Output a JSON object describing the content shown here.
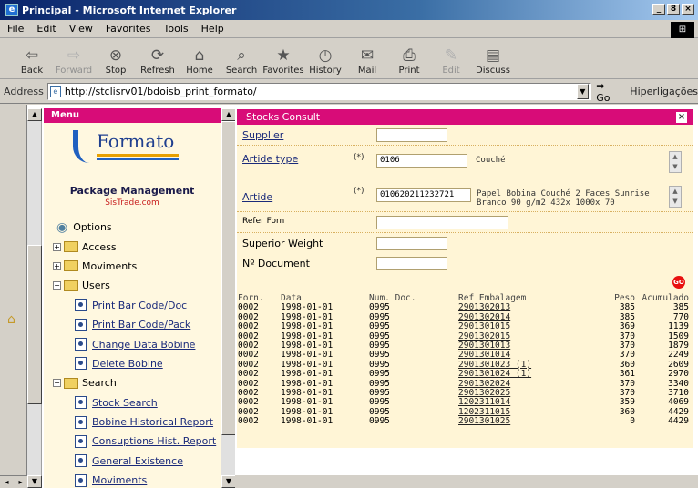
{
  "window": {
    "title": "Principal - Microsoft Internet Explorer",
    "minimize": "_",
    "restore": "8",
    "close": "×"
  },
  "menubar": [
    "File",
    "Edit",
    "View",
    "Favorites",
    "Tools",
    "Help"
  ],
  "toolbar": [
    {
      "label": "Back",
      "icon": "back-icon",
      "glyph": "⇦",
      "disabled": false
    },
    {
      "label": "Forward",
      "icon": "forward-icon",
      "glyph": "⇨",
      "disabled": true
    },
    {
      "label": "Stop",
      "icon": "stop-icon",
      "glyph": "⊗",
      "disabled": false
    },
    {
      "label": "Refresh",
      "icon": "refresh-icon",
      "glyph": "⟳",
      "disabled": false
    },
    {
      "label": "Home",
      "icon": "home-icon",
      "glyph": "⌂",
      "disabled": false
    },
    {
      "label": "Search",
      "icon": "search-icon",
      "glyph": "⌕",
      "disabled": false
    },
    {
      "label": "Favorites",
      "icon": "favorites-icon",
      "glyph": "★",
      "disabled": false
    },
    {
      "label": "History",
      "icon": "history-icon",
      "glyph": "◷",
      "disabled": false
    },
    {
      "label": "Mail",
      "icon": "mail-icon",
      "glyph": "✉",
      "disabled": false
    },
    {
      "label": "Print",
      "icon": "print-icon",
      "glyph": "⎙",
      "disabled": false
    },
    {
      "label": "Edit",
      "icon": "edit-icon",
      "glyph": "✎",
      "disabled": true
    },
    {
      "label": "Discuss",
      "icon": "discuss-icon",
      "glyph": "▤",
      "disabled": false
    }
  ],
  "address": {
    "label": "Address",
    "url": "http://stclisrv01/bdoisb_print_formato/",
    "go": "Go",
    "links": "Hiperligações"
  },
  "menu": {
    "header": "Menu",
    "brand": "Formato",
    "title": "Package Management",
    "subtitle": "SisTrade.com",
    "items": [
      {
        "label": "Options",
        "kind": "root",
        "link": false
      },
      {
        "label": "Access",
        "kind": "folder",
        "link": false
      },
      {
        "label": "Moviments",
        "kind": "folder",
        "link": false
      },
      {
        "label": "Users",
        "kind": "folder-open",
        "link": false
      },
      {
        "label": "Print Bar Code/Doc",
        "kind": "page",
        "link": true
      },
      {
        "label": "Print Bar Code/Pack",
        "kind": "page",
        "link": true
      },
      {
        "label": "Change Data Bobine",
        "kind": "page",
        "link": true
      },
      {
        "label": "Delete Bobine",
        "kind": "page",
        "link": true
      },
      {
        "label": "Search",
        "kind": "folder-open",
        "link": false
      },
      {
        "label": "Stock Search",
        "kind": "page",
        "link": true
      },
      {
        "label": "Bobine Historical Report",
        "kind": "page",
        "link": true
      },
      {
        "label": "Consuptions Hist. Report",
        "kind": "page",
        "link": true
      },
      {
        "label": "General Existence",
        "kind": "page",
        "link": true
      },
      {
        "label": "Moviments",
        "kind": "page",
        "link": true
      }
    ]
  },
  "stocks": {
    "header": "Stocks Consult",
    "close": "×",
    "supplier_label": "Supplier",
    "supplier_value": "",
    "article_type_label": "Artide type",
    "article_type_req": "(*)",
    "article_type_value": "0106",
    "article_type_desc": "Couché",
    "article_label": "Artide",
    "article_req": "(*)",
    "article_value": "010620211232721",
    "article_desc1": "Papel Bobina Couché 2 Faces Sunrise",
    "article_desc2": "Branco 90 g/m2 432x 1000x 70",
    "refer_label": "Refer Forn",
    "refer_value": "",
    "weight_label": "Superior Weight",
    "weight_value": "",
    "doc_label": "Nº Document",
    "doc_value": "",
    "go_label": "GO",
    "columns": [
      "Forn.",
      "Data",
      "Num. Doc.",
      "Ref Embalagem",
      "Peso",
      "Acumulado"
    ],
    "rows": [
      [
        "0002",
        "1998-01-01",
        "0995",
        "2901302013",
        "385",
        "385"
      ],
      [
        "0002",
        "1998-01-01",
        "0995",
        "2901302014",
        "385",
        "770"
      ],
      [
        "0002",
        "1998-01-01",
        "0995",
        "2901301015",
        "369",
        "1139"
      ],
      [
        "0002",
        "1998-01-01",
        "0995",
        "2901302015",
        "370",
        "1509"
      ],
      [
        "0002",
        "1998-01-01",
        "0995",
        "2901301013",
        "370",
        "1879"
      ],
      [
        "0002",
        "1998-01-01",
        "0995",
        "2901301014",
        "370",
        "2249"
      ],
      [
        "0002",
        "1998-01-01",
        "0995",
        "2901301023 (1)",
        "360",
        "2609"
      ],
      [
        "0002",
        "1998-01-01",
        "0995",
        "2901301024 (1)",
        "361",
        "2970"
      ],
      [
        "0002",
        "1998-01-01",
        "0995",
        "2901302024",
        "370",
        "3340"
      ],
      [
        "0002",
        "1998-01-01",
        "0995",
        "2901302025",
        "370",
        "3710"
      ],
      [
        "0002",
        "1998-01-01",
        "0995",
        "1202311014",
        "359",
        "4069"
      ],
      [
        "0002",
        "1998-01-01",
        "0995",
        "1202311015",
        "360",
        "4429"
      ],
      [
        "0002",
        "1998-01-01",
        "0995",
        "2901301025",
        "0",
        "4429"
      ]
    ]
  }
}
